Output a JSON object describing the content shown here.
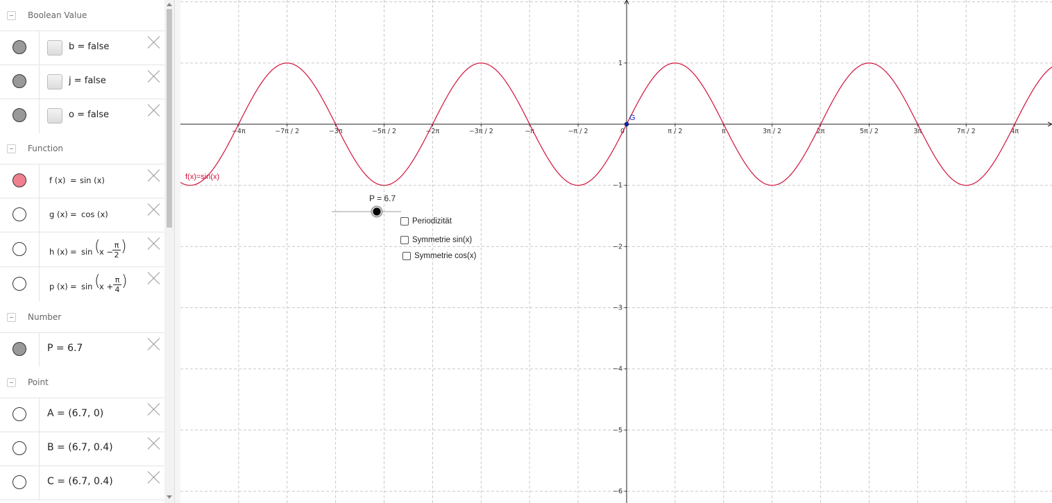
{
  "algebra": {
    "categories": {
      "boolean": "Boolean Value",
      "function": "Function",
      "number": "Number",
      "point": "Point"
    },
    "booleans": [
      {
        "text": "b = false"
      },
      {
        "text": "j = false"
      },
      {
        "text": "o = false"
      }
    ],
    "functions": [
      {
        "name": "f (x)",
        "eq": "=",
        "expr": "sin (x)",
        "visible": true
      },
      {
        "name": "g (x)",
        "eq": "=",
        "expr": "cos (x)",
        "visible": false
      },
      {
        "name": "h (x)",
        "eq": "=",
        "expr": "sin",
        "inner": "x −",
        "num": "π",
        "den": "2",
        "visible": false
      },
      {
        "name": "p (x)",
        "eq": "=",
        "expr": "sin",
        "inner": "x +",
        "num": "π",
        "den": "4",
        "visible": false
      }
    ],
    "numbers": [
      {
        "text": "P = 6.7"
      }
    ],
    "points": [
      {
        "text": "A = (6.7, 0)"
      },
      {
        "text": "B = (6.7, 0.4)"
      },
      {
        "text": "C = (6.7, 0.4)"
      }
    ]
  },
  "graphics": {
    "curve_label": "f(x)=sin(x)",
    "point_label": "G",
    "slider_label": "P = 6.7",
    "slider_value": 6.7,
    "checkboxes": [
      {
        "label": "Periodizität",
        "checked": false
      },
      {
        "label": "Symmetrie sin(x)",
        "checked": false
      },
      {
        "label": "Symmetrie cos(x)",
        "checked": false
      }
    ],
    "colors": {
      "curve": "#d0103a",
      "point": "#1020c0",
      "grid": "#c8c8c8"
    }
  },
  "chart_data": {
    "type": "line",
    "series": [
      {
        "name": "f(x)=sin(x)",
        "function": "sin(x)",
        "color": "#d0103a"
      }
    ],
    "x_ticks": [
      {
        "v": -12.566,
        "label": "−4π"
      },
      {
        "v": -10.996,
        "label": "−7π / 2"
      },
      {
        "v": -9.425,
        "label": "−3π"
      },
      {
        "v": -7.854,
        "label": "−5π / 2"
      },
      {
        "v": -6.283,
        "label": "−2π"
      },
      {
        "v": -4.712,
        "label": "−3π / 2"
      },
      {
        "v": -3.142,
        "label": "−π"
      },
      {
        "v": -1.571,
        "label": "−π / 2"
      },
      {
        "v": 0,
        "label": "0"
      },
      {
        "v": 1.571,
        "label": "π / 2"
      },
      {
        "v": 3.142,
        "label": "π"
      },
      {
        "v": 4.712,
        "label": "3π / 2"
      },
      {
        "v": 6.283,
        "label": "2π"
      },
      {
        "v": 7.854,
        "label": "5π / 2"
      },
      {
        "v": 9.425,
        "label": "3π"
      },
      {
        "v": 10.996,
        "label": "7π / 2"
      },
      {
        "v": 12.566,
        "label": "4π"
      }
    ],
    "y_ticks": [
      {
        "v": 1,
        "label": "1"
      },
      {
        "v": -1,
        "label": "−1"
      },
      {
        "v": -2,
        "label": "−2"
      },
      {
        "v": -3,
        "label": "−3"
      },
      {
        "v": -4,
        "label": "−4"
      },
      {
        "v": -5,
        "label": "−5"
      },
      {
        "v": -6,
        "label": "−6"
      }
    ],
    "xlim": [
      -14.45,
      13.8
    ],
    "ylim": [
      -6.15,
      2.03
    ],
    "grid": true,
    "points": [
      {
        "name": "G",
        "x": 0,
        "y": 0
      }
    ]
  }
}
